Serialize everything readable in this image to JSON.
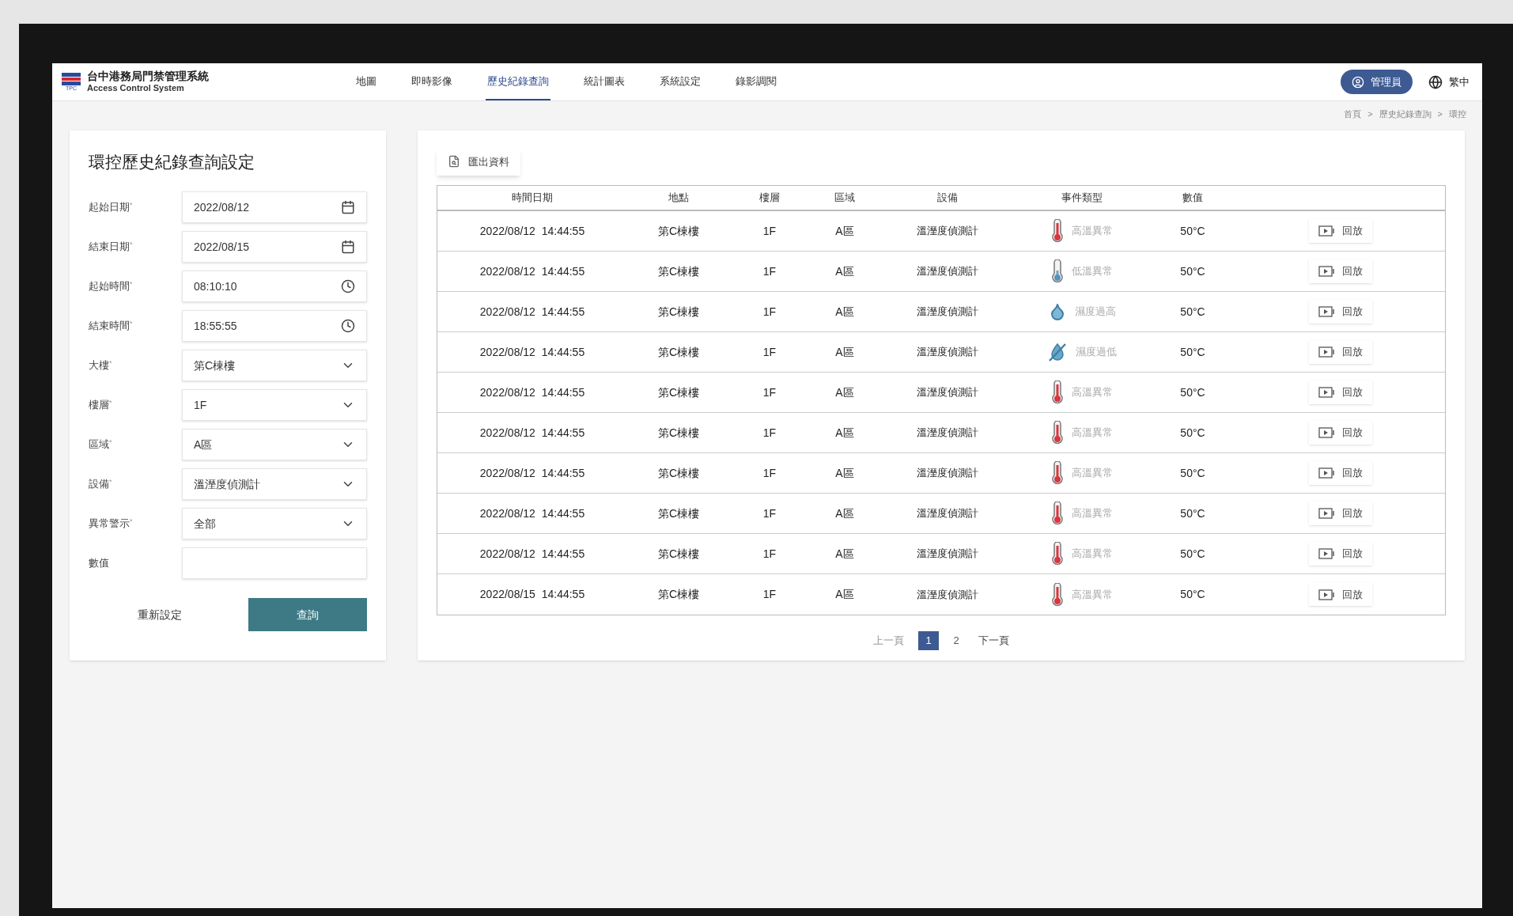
{
  "header": {
    "logo_text": "TPC",
    "title": "台中港務局門禁管理系統",
    "subtitle": "Access Control System",
    "nav": [
      {
        "label": "地圖",
        "selected": false
      },
      {
        "label": "即時影像",
        "selected": false
      },
      {
        "label": "歷史紀錄查詢",
        "selected": true
      },
      {
        "label": "統計圖表",
        "selected": false
      },
      {
        "label": "系統設定",
        "selected": false
      },
      {
        "label": "錄影調閱",
        "selected": false
      }
    ],
    "user": "管理員",
    "language": "繁中"
  },
  "breadcrumb": [
    "首頁",
    ">",
    "歷史紀錄查詢",
    ">",
    "環控"
  ],
  "form": {
    "title": "環控歷史紀錄查詢設定",
    "fields": [
      {
        "label": "起始日期",
        "required_mark": "*",
        "kind": "date",
        "value": "2022/08/12"
      },
      {
        "label": "結束日期",
        "required_mark": "*",
        "kind": "date",
        "value": "2022/08/15"
      },
      {
        "label": "起始時間",
        "required_mark": "*",
        "kind": "time",
        "value": "08:10:10"
      },
      {
        "label": "結束時間",
        "required_mark": "*",
        "kind": "time",
        "value": "18:55:55"
      },
      {
        "label": "大樓",
        "required_mark": "*",
        "kind": "select",
        "value": "第C棟樓"
      },
      {
        "label": "樓層",
        "required_mark": "*",
        "kind": "select",
        "value": "1F"
      },
      {
        "label": "區域",
        "required_mark": "*",
        "kind": "select",
        "value": "A區"
      },
      {
        "label": "設備",
        "required_mark": "*",
        "kind": "select",
        "value": "溫溼度偵測計"
      },
      {
        "label": "異常警示",
        "required_mark": "*",
        "kind": "select",
        "value": "全部"
      },
      {
        "label": "數值",
        "kind": "text"
      }
    ],
    "reset_button": "重新設定",
    "query_button": "查詢"
  },
  "export_button": "匯出資料",
  "table": {
    "columns": [
      "時間日期",
      "地點",
      "樓層",
      "區域",
      "設備",
      "事件類型",
      "數值"
    ],
    "rows": [
      {
        "datetime": "2022/08/12  14:44:55",
        "location": "第C棟樓",
        "floor": "1F",
        "area": "A區",
        "device": "溫溼度偵測計",
        "kind": "high_temp",
        "event": "高溫異常",
        "value": "50°C",
        "action": "回放"
      },
      {
        "datetime": "2022/08/12  14:44:55",
        "location": "第C棟樓",
        "floor": "1F",
        "area": "A區",
        "device": "溫溼度偵測計",
        "kind": "low_temp",
        "event": "低溫異常",
        "value": "50°C",
        "action": "回放"
      },
      {
        "datetime": "2022/08/12  14:44:55",
        "location": "第C棟樓",
        "floor": "1F",
        "area": "A區",
        "device": "溫溼度偵測計",
        "kind": "humidity_high",
        "event": "濕度過高",
        "value": "50°C",
        "action": "回放"
      },
      {
        "datetime": "2022/08/12  14:44:55",
        "location": "第C棟樓",
        "floor": "1F",
        "area": "A區",
        "device": "溫溼度偵測計",
        "kind": "humidity_low",
        "event": "濕度過低",
        "value": "50°C",
        "action": "回放"
      },
      {
        "datetime": "2022/08/12  14:44:55",
        "location": "第C棟樓",
        "floor": "1F",
        "area": "A區",
        "device": "溫溼度偵測計",
        "kind": "high_temp",
        "event": "高溫異常",
        "value": "50°C",
        "action": "回放"
      },
      {
        "datetime": "2022/08/12  14:44:55",
        "location": "第C棟樓",
        "floor": "1F",
        "area": "A區",
        "device": "溫溼度偵測計",
        "kind": "high_temp",
        "event": "高溫異常",
        "value": "50°C",
        "action": "回放"
      },
      {
        "datetime": "2022/08/12  14:44:55",
        "location": "第C棟樓",
        "floor": "1F",
        "area": "A區",
        "device": "溫溼度偵測計",
        "kind": "high_temp",
        "event": "高溫異常",
        "value": "50°C",
        "action": "回放"
      },
      {
        "datetime": "2022/08/12  14:44:55",
        "location": "第C棟樓",
        "floor": "1F",
        "area": "A區",
        "device": "溫溼度偵測計",
        "kind": "high_temp",
        "event": "高溫異常",
        "value": "50°C",
        "action": "回放"
      },
      {
        "datetime": "2022/08/12  14:44:55",
        "location": "第C棟樓",
        "floor": "1F",
        "area": "A區",
        "device": "溫溼度偵測計",
        "kind": "high_temp",
        "event": "高溫異常",
        "value": "50°C",
        "action": "回放"
      },
      {
        "datetime": "2022/08/15  14:44:55",
        "location": "第C棟樓",
        "floor": "1F",
        "area": "A區",
        "device": "溫溼度偵測計",
        "kind": "high_temp",
        "event": "高溫異常",
        "value": "50°C",
        "action": "回放"
      }
    ]
  },
  "pagination": {
    "previous": "上一頁",
    "pages": [
      {
        "label": "1",
        "selected": true
      },
      {
        "label": "2",
        "selected": false
      }
    ],
    "next": "下一頁"
  }
}
